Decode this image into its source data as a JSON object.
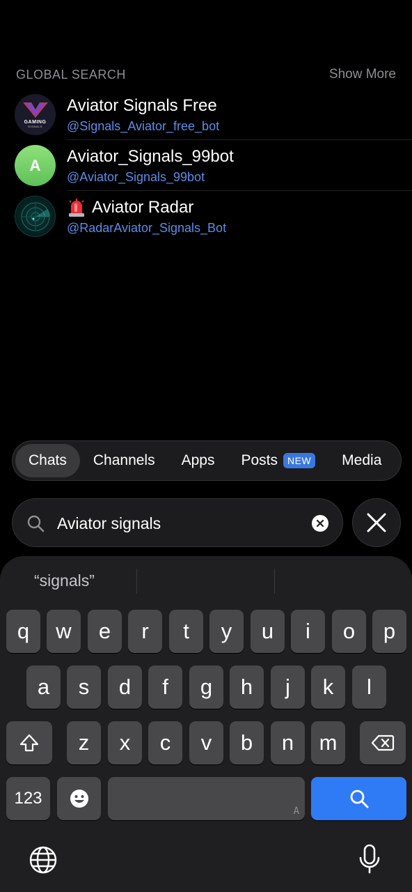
{
  "global_search": {
    "title": "GLOBAL SEARCH",
    "show_more": "Show More"
  },
  "results": [
    {
      "name": "Aviator Signals Free",
      "handle": "@Signals_Aviator_free_bot",
      "avatar_text": "GAMING",
      "avatar_subtext": "SIGNALS"
    },
    {
      "name": "Aviator_Signals_99bot",
      "handle": "@Aviator_Signals_99bot",
      "avatar_text": "A"
    },
    {
      "name": "Aviator Radar",
      "handle": "@RadarAviator_Signals_Bot",
      "emoji": "siren-icon"
    }
  ],
  "tabs": [
    {
      "label": "Chats",
      "active": true
    },
    {
      "label": "Channels"
    },
    {
      "label": "Apps"
    },
    {
      "label": "Posts",
      "badge": "NEW"
    },
    {
      "label": "Media"
    }
  ],
  "search": {
    "value": "Aviator signals"
  },
  "keyboard": {
    "suggestion": "“signals”",
    "row1": [
      "q",
      "w",
      "e",
      "r",
      "t",
      "y",
      "u",
      "i",
      "o",
      "p"
    ],
    "row2": [
      "a",
      "s",
      "d",
      "f",
      "g",
      "h",
      "j",
      "k",
      "l"
    ],
    "row3": [
      "z",
      "x",
      "c",
      "v",
      "b",
      "n",
      "m"
    ],
    "numbers_label": "123",
    "space_hint": "A"
  },
  "colors": {
    "accent": "#2f7bf5",
    "link": "#5b8ee6",
    "background": "#000000"
  }
}
